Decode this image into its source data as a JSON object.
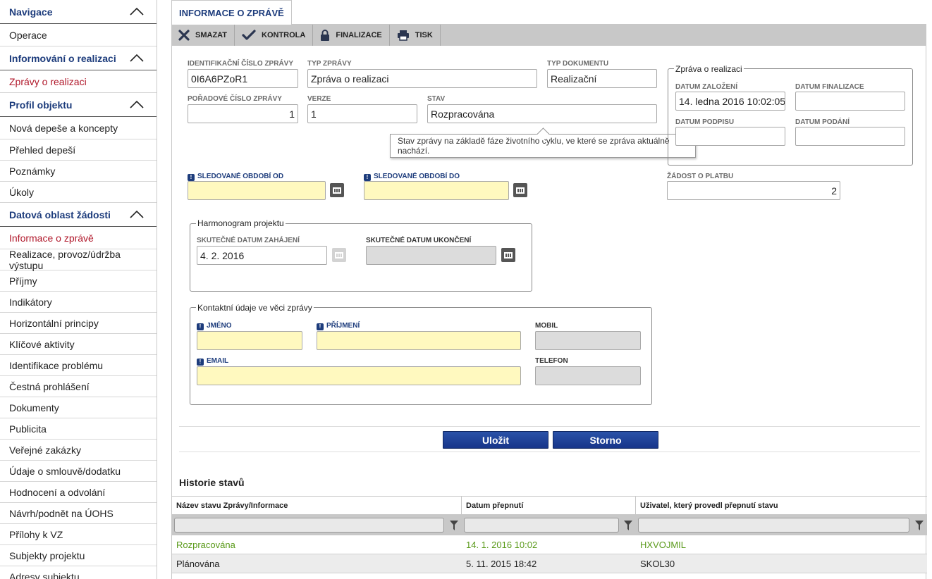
{
  "sidebar": {
    "sections": [
      {
        "title": "Navigace",
        "items": [
          "Operace"
        ]
      },
      {
        "title": "Informování o realizaci",
        "items": [
          "Zprávy o realizaci"
        ]
      },
      {
        "title": "Profil objektu",
        "items": [
          "Nová depeše a koncepty",
          "Přehled depeší",
          "Poznámky",
          "Úkoly"
        ]
      },
      {
        "title": "Datová oblast žádosti",
        "items": [
          "Informace o zprávě",
          "Realizace, provoz/údržba výstupu",
          "Příjmy",
          "Indikátory",
          "Horizontální principy",
          "Klíčové aktivity",
          "Identifikace problému",
          "Čestná prohlášení",
          "Dokumenty",
          "Publicita",
          "Veřejné zakázky",
          "Údaje o smlouvě/dodatku",
          "Hodnocení a odvolání",
          "Návrh/podnět na ÚOHS",
          "Přílohy k VZ",
          "Subjekty projektu",
          "Adresy subjektu"
        ]
      }
    ],
    "active_items": [
      "Zprávy o realizaci",
      "Informace o zprávě"
    ]
  },
  "tab": {
    "label": "INFORMACE O ZPRÁVĚ"
  },
  "toolbar": {
    "delete": "SMAZAT",
    "check": "KONTROLA",
    "finalize": "FINALIZACE",
    "print": "TISK"
  },
  "form": {
    "report_id_label": "IDENTIFIKAČNÍ ČÍSLO ZPRÁVY",
    "report_id_value": "0I6A6PZoR1",
    "report_type_label": "TYP ZPRÁVY",
    "report_type_value": "Zpráva o realizaci",
    "doc_type_label": "TYP DOKUMENTU",
    "doc_type_value": "Realizační",
    "order_label": "POŘADOVÉ ČÍSLO ZPRÁVY",
    "order_value": "1",
    "version_label": "VERZE",
    "version_value": "1",
    "state_label": "STAV",
    "state_value": "Rozpracována",
    "tooltip": "Stav zprávy na základě fáze životního cyklu, ve které se zpráva aktuálně nachází.",
    "period_from_label": "SLEDOVANÉ OBDOBÍ OD",
    "period_from_value": "",
    "period_to_label": "SLEDOVANÉ OBDOBÍ DO",
    "period_to_value": "",
    "payment_request_label": "ŽÁDOST O PLATBU",
    "payment_request_value": "2",
    "report_group": {
      "title": "Zpráva o realizaci",
      "created_label": "DATUM ZALOŽENÍ",
      "created_value": "14. ledna 2016 10:02:05",
      "finalized_label": "DATUM FINALIZACE",
      "finalized_value": "",
      "signed_label": "DATUM PODPISU",
      "signed_value": "",
      "submitted_label": "DATUM PODÁNÍ",
      "submitted_value": ""
    },
    "schedule_group": {
      "title": "Harmonogram projektu",
      "start_label": "SKUTEČNÉ DATUM ZAHÁJENÍ",
      "start_value": "4. 2. 2016",
      "end_label": "SKUTEČNÉ DATUM UKONČENÍ",
      "end_value": ""
    },
    "contact_group": {
      "title": "Kontaktní údaje ve věci zprávy",
      "first_name_label": "JMÉNO",
      "last_name_label": "PŘÍJMENÍ",
      "mobile_label": "MOBIL",
      "email_label": "EMAIL",
      "phone_label": "TELEFON"
    },
    "save_label": "Uložit",
    "cancel_label": "Storno"
  },
  "history": {
    "title": "Historie stavů",
    "columns": [
      "Název stavu Zprávy/Informace",
      "Datum přepnutí",
      "Uživatel, který provedl přepnutí stavu"
    ],
    "rows": [
      [
        "Rozpracována",
        "14. 1. 2016 10:02",
        "HXVOJMIL"
      ],
      [
        "Plánována",
        "5. 11. 2015 18:42",
        "SKOL30"
      ]
    ]
  },
  "colors": {
    "brand": "#1d3c7c",
    "active": "#b0172a",
    "required": "#fff9bf",
    "current_state": "#5a9a1a"
  }
}
